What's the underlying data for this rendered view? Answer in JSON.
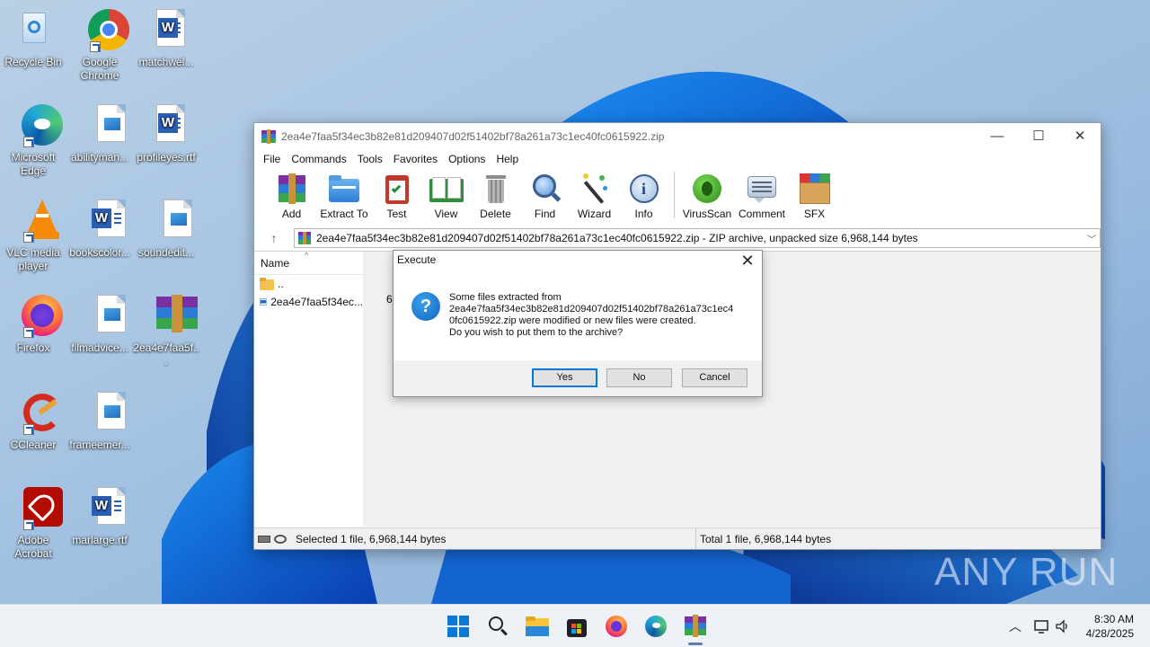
{
  "desktop": {
    "icons": [
      {
        "label": "Recycle Bin"
      },
      {
        "label": "Google Chrome"
      },
      {
        "label": "matchwel..."
      },
      {
        "label": "Microsoft Edge"
      },
      {
        "label": "abilityman..."
      },
      {
        "label": "profileyes.rtf"
      },
      {
        "label": "VLC media player"
      },
      {
        "label": "bookscolor..."
      },
      {
        "label": "soundedit..."
      },
      {
        "label": "Firefox"
      },
      {
        "label": "filmadvice..."
      },
      {
        "label": "2ea4e7faa5f..."
      },
      {
        "label": "CCleaner"
      },
      {
        "label": "frameemer..."
      },
      {
        "label": "Adobe Acrobat"
      },
      {
        "label": "marlarge.rtf"
      }
    ]
  },
  "window": {
    "title": "2ea4e7faa5f34ec3b82e81d209407d02f51402bf78a261a73c1ec40fc0615922.zip",
    "controls": {
      "minimize": "—",
      "maximize": "☐",
      "close": "✕"
    },
    "menu": [
      "File",
      "Commands",
      "Tools",
      "Favorites",
      "Options",
      "Help"
    ],
    "toolbar": [
      "Add",
      "Extract To",
      "Test",
      "View",
      "Delete",
      "Find",
      "Wizard",
      "Info",
      "VirusScan",
      "Comment",
      "SFX"
    ],
    "address": "2ea4e7faa5f34ec3b82e81d209407d02f51402bf78a261a73c1ec40fc0615922.zip - ZIP archive, unpacked size 6,968,144 bytes",
    "list": {
      "column_name": "Name",
      "rows": [
        {
          "name": ".."
        },
        {
          "name": "2ea4e7faa5f34ec..."
        }
      ],
      "size_peek": "6,"
    },
    "status": {
      "left": "Selected 1 file, 6,968,144 bytes",
      "right": "Total 1 file, 6,968,144 bytes"
    }
  },
  "dialog": {
    "title": "Execute",
    "close": "✕",
    "message_lines": [
      "Some files extracted from",
      "2ea4e7faa5f34ec3b82e81d209407d02f51402bf78a261a73c1ec4",
      "0fc0615922.zip were modified or new files were created.",
      "Do you wish to put them to the archive?"
    ],
    "buttons": {
      "yes": "Yes",
      "no": "No",
      "cancel": "Cancel"
    }
  },
  "taskbar": {
    "apps": [
      "start-icon",
      "search-icon",
      "file-explorer-icon",
      "store-icon",
      "firefox-icon",
      "edge-icon",
      "winrar-icon"
    ],
    "time": "8:30 AM",
    "date": "4/28/2025"
  },
  "watermark": "ANY RUN",
  "colors": {
    "accent": "#0078d7",
    "selected_row": "#cce8ff",
    "dialog_footer": "#f0f0f0"
  }
}
